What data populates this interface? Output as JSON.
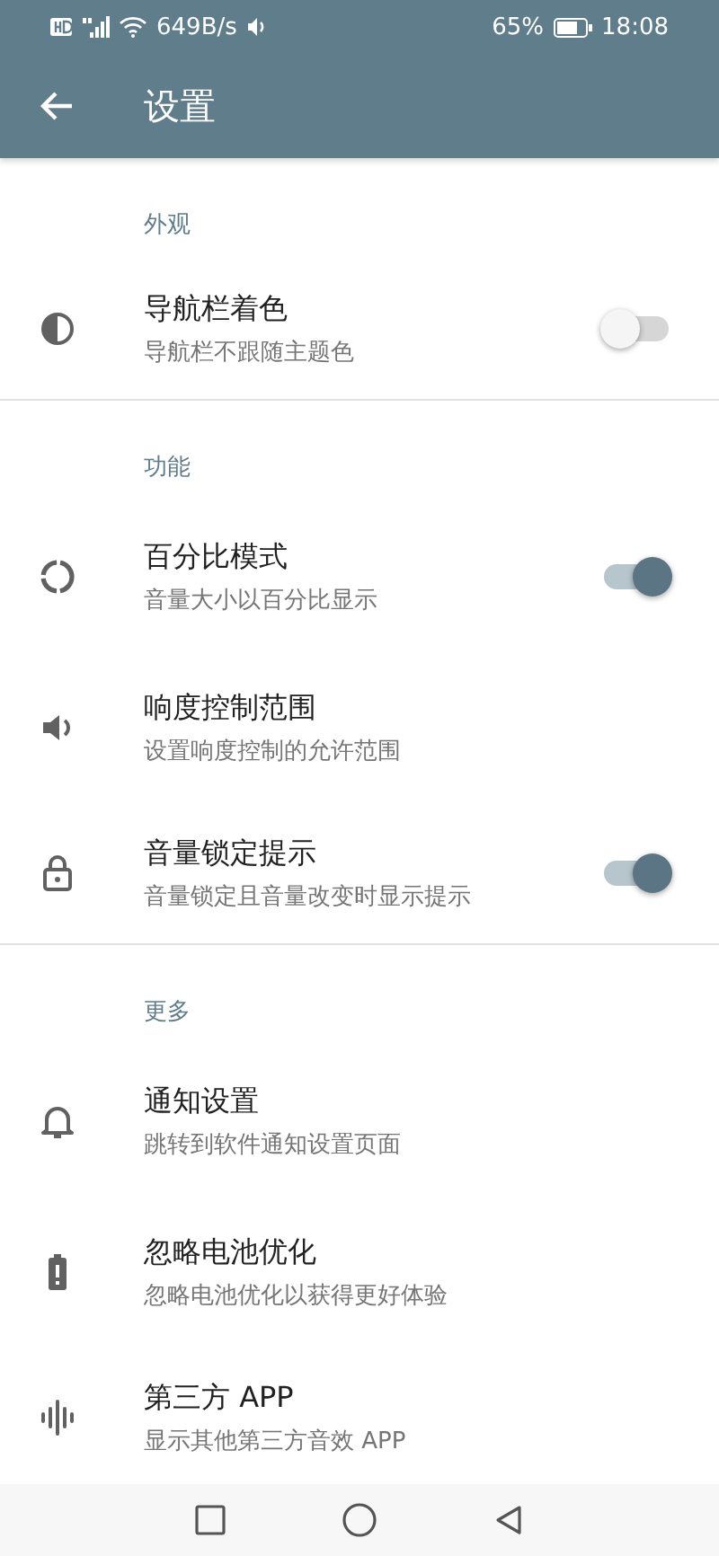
{
  "status_bar": {
    "speed": "649B/s",
    "battery": "65%",
    "time": "18:08"
  },
  "app_bar": {
    "title": "设置"
  },
  "sections": [
    {
      "header": "外观",
      "items": [
        {
          "kind": "switch",
          "title": "导航栏着色",
          "subtitle": "导航栏不跟随主题色",
          "on": false
        }
      ]
    },
    {
      "header": "功能",
      "items": [
        {
          "kind": "switch",
          "title": "百分比模式",
          "subtitle": "音量大小以百分比显示",
          "on": true
        },
        {
          "kind": "plain",
          "title": "响度控制范围",
          "subtitle": "设置响度控制的允许范围"
        },
        {
          "kind": "switch",
          "title": "音量锁定提示",
          "subtitle": "音量锁定且音量改变时显示提示",
          "on": true
        }
      ]
    },
    {
      "header": "更多",
      "items": [
        {
          "kind": "plain",
          "title": "通知设置",
          "subtitle": "跳转到软件通知设置页面"
        },
        {
          "kind": "plain",
          "title": "忽略电池优化",
          "subtitle": "忽略电池优化以获得更好体验"
        },
        {
          "kind": "plain",
          "title": "第三方 APP",
          "subtitle": "显示其他第三方音效 APP"
        }
      ]
    }
  ]
}
